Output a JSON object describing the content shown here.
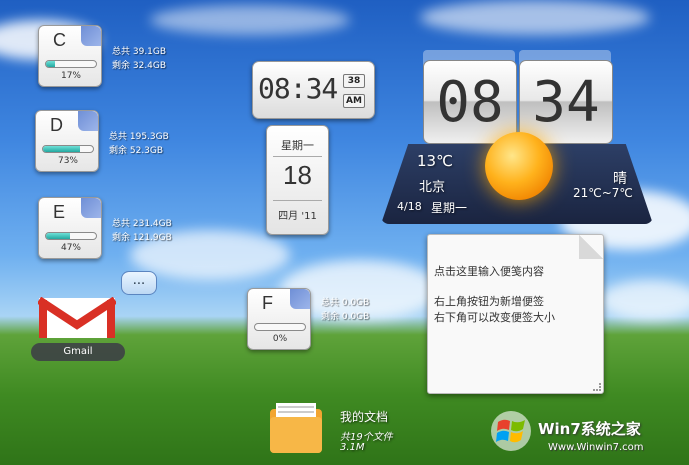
{
  "drives": [
    {
      "letter": "C",
      "percent": 17,
      "pct_label": "17%",
      "total": "总共 39.1GB",
      "free": "剩余 32.4GB"
    },
    {
      "letter": "D",
      "percent": 73,
      "pct_label": "73%",
      "total": "总共 195.3GB",
      "free": "剩余 52.3GB"
    },
    {
      "letter": "E",
      "percent": 47,
      "pct_label": "47%",
      "total": "总共 231.4GB",
      "free": "剩余 121.9GB"
    },
    {
      "letter": "F",
      "percent": 0,
      "pct_label": "0%",
      "total": "总共 0.0GB",
      "free": "剩余 0.0GB"
    }
  ],
  "clock_small": {
    "time": "08:34",
    "seconds": "38",
    "ampm": "AM"
  },
  "calendar": {
    "weekday": "星期一",
    "day": "18",
    "month": "四月 '11"
  },
  "weather": {
    "hour": "08",
    "minute": "34",
    "temp": "13℃",
    "city": "北京",
    "date": "4/18",
    "weekday": "星期一",
    "condition": "晴",
    "range": "21℃~7℃"
  },
  "note": {
    "line1": "点击这里输入便笺内容",
    "line2": "右上角按钮为新增便签",
    "line3": "右下角可以改变便签大小"
  },
  "more_label": "...",
  "gmail": {
    "label": "Gmail"
  },
  "documents": {
    "title": "我的文档",
    "count": "共19个文件",
    "size": "3.1M"
  },
  "watermark": {
    "text": "Win7系统之家",
    "url": "Www.Winwin7.com"
  },
  "colors": {
    "drive_fill": "#23a8a0",
    "folder": "#f2a531",
    "gmail_red": "#d93025"
  }
}
